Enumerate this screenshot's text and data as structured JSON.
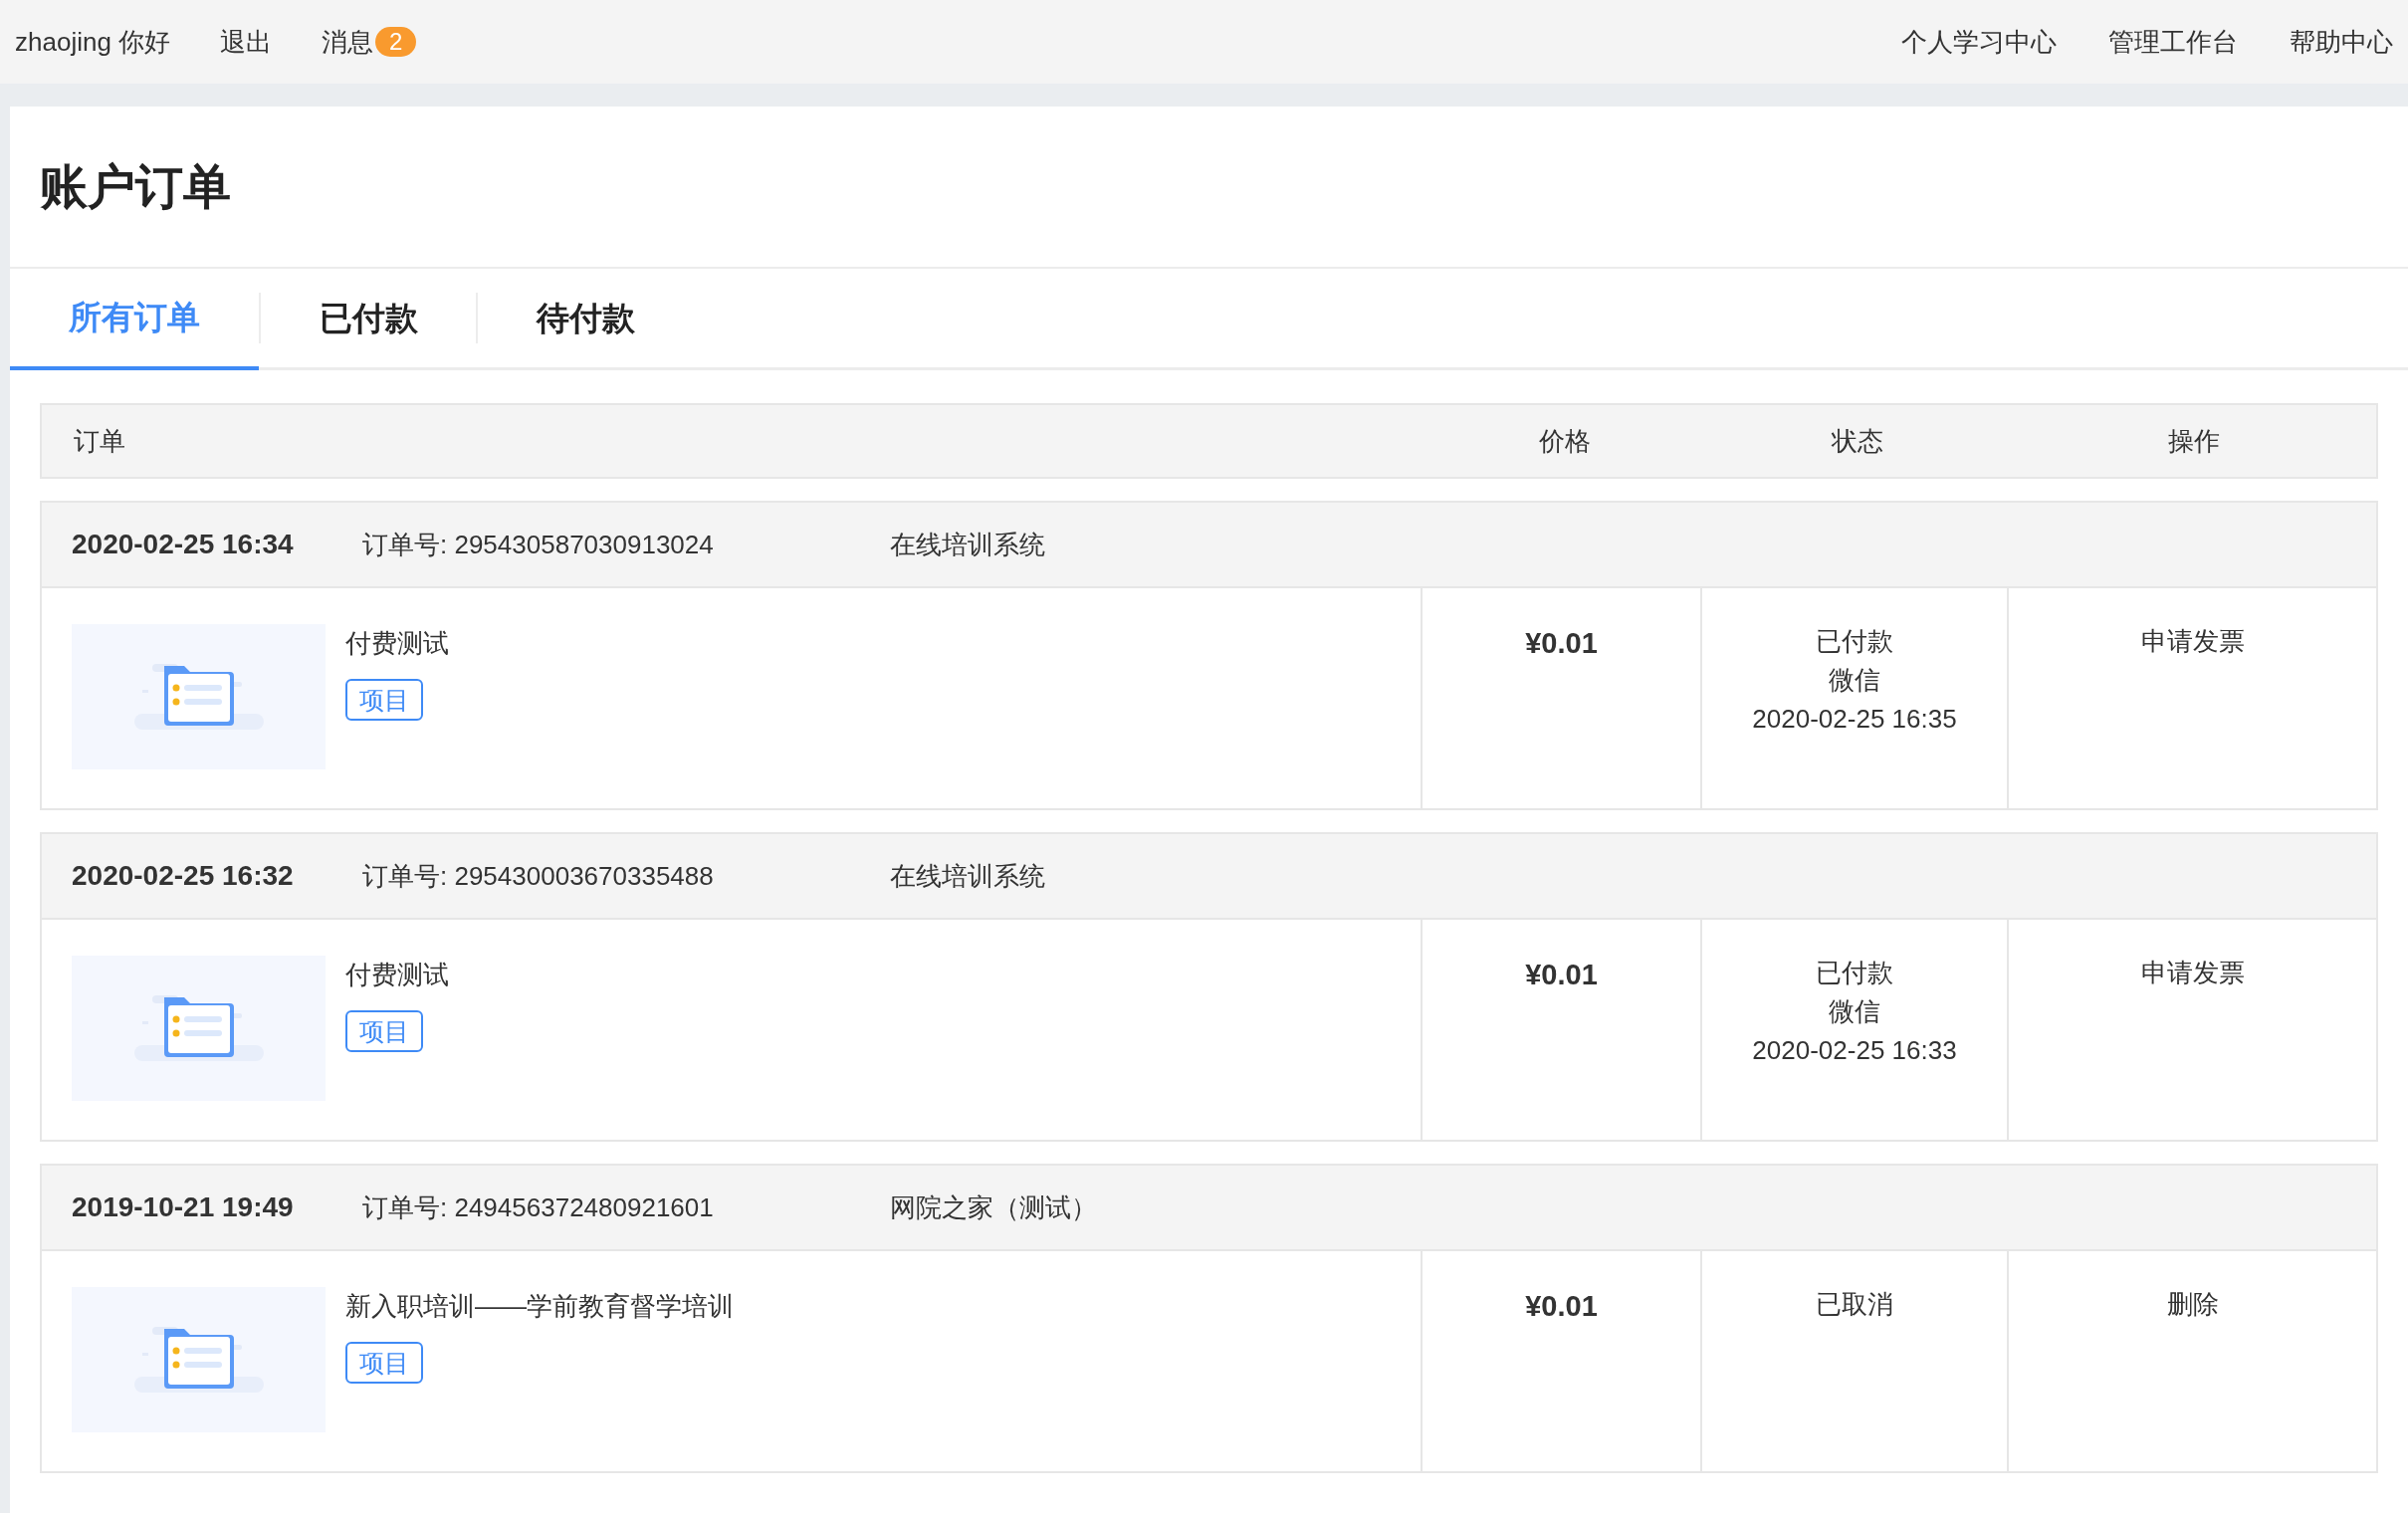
{
  "top_bar": {
    "greeting": "zhaojing 你好",
    "logout": "退出",
    "messages": {
      "label": "消息",
      "count": "2"
    },
    "links": [
      "个人学习中心",
      "管理工作台",
      "帮助中心"
    ]
  },
  "title": "账户订单",
  "tabs": [
    {
      "label": "所有订单",
      "selected": true
    },
    {
      "label": "已付款",
      "selected": false
    },
    {
      "label": "待付款",
      "selected": false
    }
  ],
  "table": {
    "columns": [
      "订单",
      "价格",
      "状态",
      "操作"
    ],
    "orders": [
      {
        "time": "2020-02-25 16:34",
        "order_no": "订单号: 295430587030913024",
        "source": "在线培训系统",
        "item": "付费测试",
        "tag": "项目",
        "price": "¥0.01",
        "status": [
          "已付款",
          "微信",
          "2020-02-25 16:35"
        ],
        "action": "申请发票"
      },
      {
        "time": "2020-02-25 16:32",
        "order_no": "订单号: 295430003670335488",
        "source": "在线培训系统",
        "item": "付费测试",
        "tag": "项目",
        "price": "¥0.01",
        "status": [
          "已付款",
          "微信",
          "2020-02-25 16:33"
        ],
        "action": "申请发票"
      },
      {
        "time": "2019-10-21 19:49",
        "order_no": "订单号: 249456372480921601",
        "source": "网院之家（测试）",
        "item": "新入职培训——学前教育督学培训",
        "tag": "项目",
        "price": "¥0.01",
        "status": [
          "已取消"
        ],
        "action": "删除"
      }
    ]
  }
}
